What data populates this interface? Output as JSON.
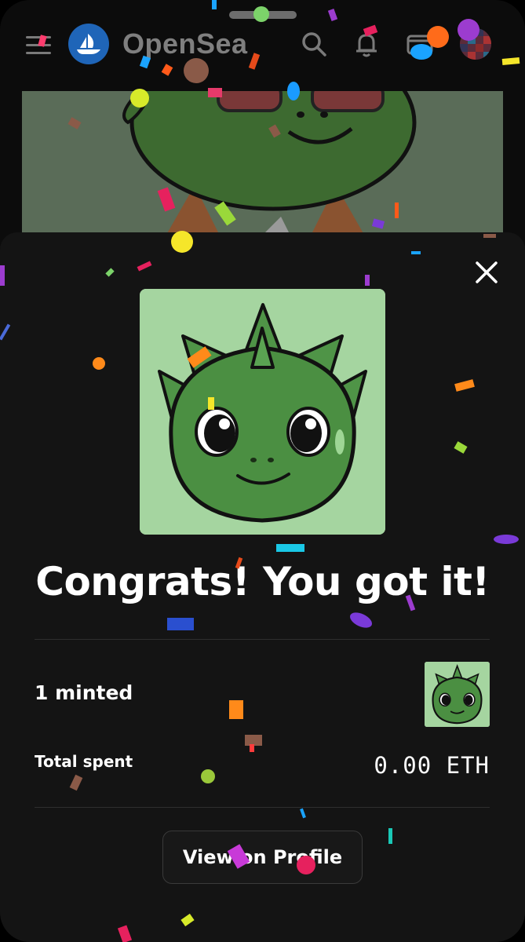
{
  "header": {
    "brand": "OpenSea",
    "icons": [
      "menu-icon",
      "opensea-logo-icon",
      "search-icon",
      "bell-icon",
      "wallet-icon",
      "avatar"
    ]
  },
  "modal": {
    "headline": "Congrats! You got it!",
    "minted_label": "1 minted",
    "total_spent_label": "Total spent",
    "total_spent_value": "0.00 ETH",
    "view_button_label": "View on Profile",
    "close_icon": "close-icon"
  },
  "colors": {
    "background": "#141414",
    "nft_background": "#a5d5a0",
    "character_green": "#4b8f42",
    "logo_blue": "#1f65b8"
  }
}
